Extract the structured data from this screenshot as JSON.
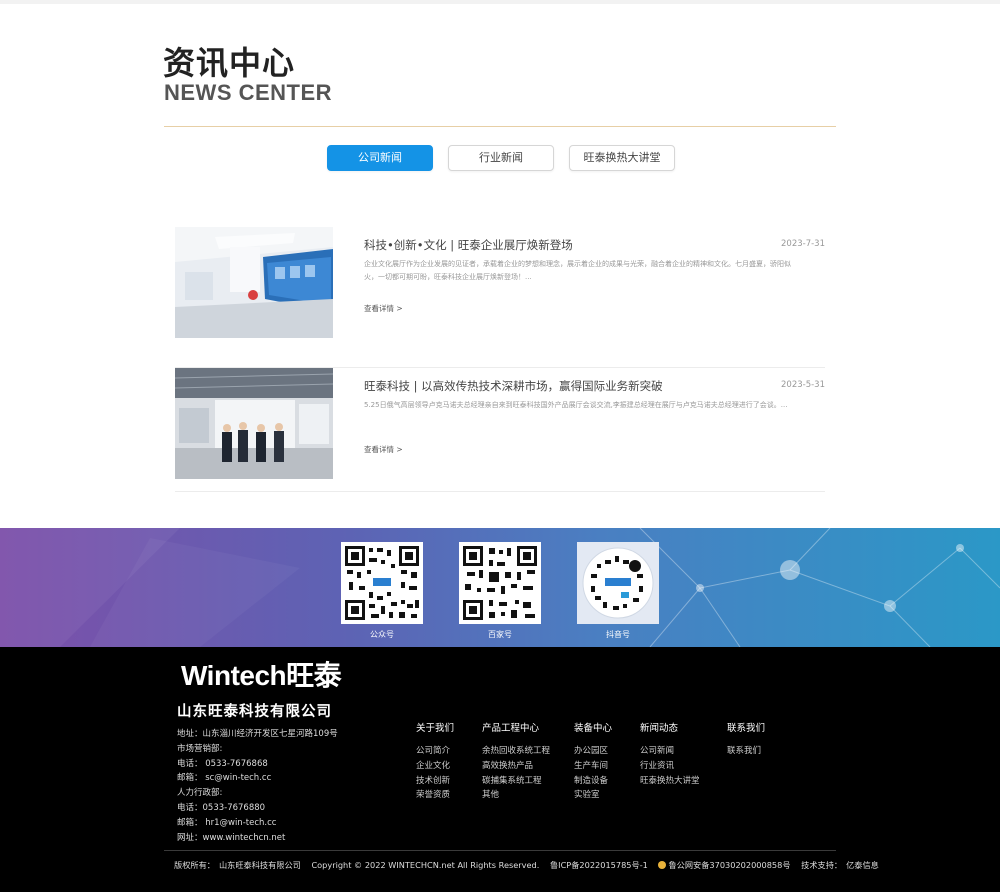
{
  "header": {
    "title_cn": "资讯中心",
    "title_en": "NEWS CENTER"
  },
  "tabs": [
    {
      "label": "公司新闻",
      "active": true
    },
    {
      "label": "行业新闻",
      "active": false
    },
    {
      "label": "旺泰换热大讲堂",
      "active": false
    }
  ],
  "news": [
    {
      "title": "科技•创新•文化 | 旺泰企业展厅焕新登场",
      "date": "2023-7-31",
      "summary": "企业文化展厅作为企业发展的见证者，承载着企业的梦想和理念，展示着企业的成果与光荣，融合着企业的精神和文化。七月盛夏，骄阳似火，一切都可期可盼，旺泰科技企业展厅焕新登场！...",
      "more": "查看详情 >"
    },
    {
      "title": "旺泰科技 | 以高效传热技术深耕市场，赢得国际业务新突破",
      "date": "2023-5-31",
      "summary": "5.25日俄气高层领导卢克马诺夫总经理亲自来到旺泰科技国外产品展厅会谈交流,李振建总经理在展厅与卢克马诺夫总经理进行了会谈。...",
      "more": "查看详情 >"
    }
  ],
  "qr": [
    {
      "label": "公众号"
    },
    {
      "label": "百家号"
    },
    {
      "label": "抖音号"
    }
  ],
  "footer": {
    "logo": "Wintech旺泰",
    "company": "山东旺泰科技有限公司",
    "contact": [
      "地址：山东淄川经济开发区七星河路109号",
      "市场营销部:",
      "电话： 0533-7676868",
      "邮箱： sc@win-tech.cc",
      "人力行政部:",
      "电话：0533-7676880",
      "邮箱： hr1@win-tech.cc",
      "网址：www.wintechcn.net"
    ],
    "columns": [
      {
        "head": "关于我们",
        "links": [
          "公司简介",
          "企业文化",
          "技术创新",
          "荣誉资质"
        ]
      },
      {
        "head": "产品工程中心",
        "links": [
          "余热回收系统工程",
          "高效换热产品",
          "碳捕集系统工程",
          "其他"
        ]
      },
      {
        "head": "装备中心",
        "links": [
          "办公园区",
          "生产车间",
          "制造设备",
          "实验室"
        ]
      },
      {
        "head": "新闻动态",
        "links": [
          "公司新闻",
          "行业资讯",
          "旺泰换热大讲堂"
        ]
      },
      {
        "head": "联系我们",
        "links": [
          "联系我们"
        ]
      }
    ],
    "copyright": {
      "owner_label": "版权所有：",
      "owner": "山东旺泰科技有限公司",
      "copy": "Copyright © 2022 WINTECHCN.net All Rights Reserved.",
      "icp": "鲁ICP备2022015785号-1",
      "police": "鲁公网安备37030202000858号",
      "tech_label": "技术支持：",
      "tech": "亿泰信息"
    }
  },
  "colors": {
    "accent": "#1493e6",
    "divider": "#e7cfa6",
    "footer_bg": "#000000"
  }
}
